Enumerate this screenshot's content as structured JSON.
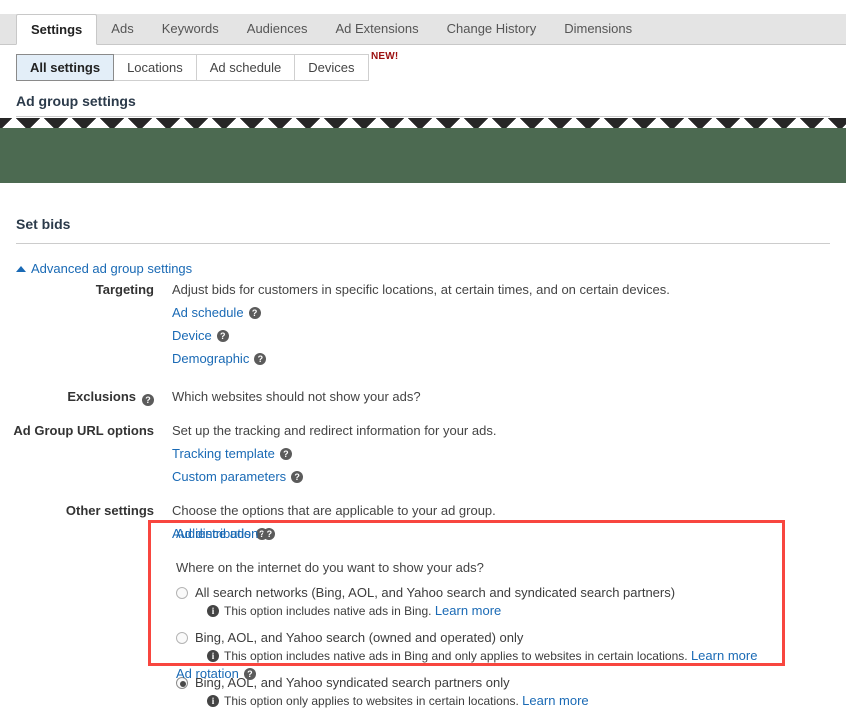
{
  "tabs": {
    "items": [
      {
        "label": "Settings",
        "active": true
      },
      {
        "label": "Ads",
        "active": false
      },
      {
        "label": "Keywords",
        "active": false
      },
      {
        "label": "Audiences",
        "active": false
      },
      {
        "label": "Ad Extensions",
        "active": false
      },
      {
        "label": "Change History",
        "active": false
      },
      {
        "label": "Dimensions",
        "active": false
      }
    ]
  },
  "subtabs": {
    "items": [
      {
        "label": "All settings",
        "active": true
      },
      {
        "label": "Locations",
        "active": false
      },
      {
        "label": "Ad schedule",
        "active": false
      },
      {
        "label": "Devices",
        "active": false
      }
    ],
    "badge": "NEW!"
  },
  "sections": {
    "ad_group_settings_title": "Ad group settings",
    "set_bids_title": "Set bids",
    "advanced_link": "Advanced ad group settings"
  },
  "form": {
    "targeting": {
      "label": "Targeting",
      "description": "Adjust bids for customers in specific locations, at certain times, and on certain devices.",
      "links": [
        "Ad schedule",
        "Device",
        "Demographic"
      ]
    },
    "exclusions": {
      "label": "Exclusions",
      "description": "Which websites should not show your ads?"
    },
    "url_options": {
      "label": "Ad Group URL options",
      "description": "Set up the tracking and redirect information for your ads.",
      "links": [
        "Tracking template",
        "Custom parameters"
      ]
    },
    "other_settings": {
      "label": "Other settings",
      "description": "Choose the options that are applicable to your ad group.",
      "audience_ads_link": "Audience ads"
    }
  },
  "ad_distribution": {
    "link": "Ad distribution",
    "question": "Where on the internet do you want to show your ads?",
    "options": [
      {
        "label": "All search networks (Bing, AOL, and Yahoo search and syndicated search partners)",
        "note": "This option includes native ads in Bing.",
        "learn_more": "Learn more",
        "selected": false
      },
      {
        "label": "Bing, AOL, and Yahoo search (owned and operated) only",
        "note": "This option includes native ads in Bing and only applies to websites in certain locations.",
        "learn_more": "Learn more",
        "selected": false
      },
      {
        "label": "Bing, AOL, and Yahoo syndicated search partners only",
        "note": "This option only applies to websites in certain locations.",
        "learn_more": "Learn more",
        "selected": true
      }
    ]
  },
  "ad_rotation": {
    "link": "Ad rotation"
  },
  "icons": {
    "help": "?",
    "info": "i",
    "caret_up": "caret-up-icon"
  },
  "colors": {
    "link": "#1a6ab5",
    "highlight_box": "#f8463f",
    "redaction_green": "#4c6a51",
    "badge_red": "#9c1111",
    "active_subtab": "#e3eef8"
  }
}
